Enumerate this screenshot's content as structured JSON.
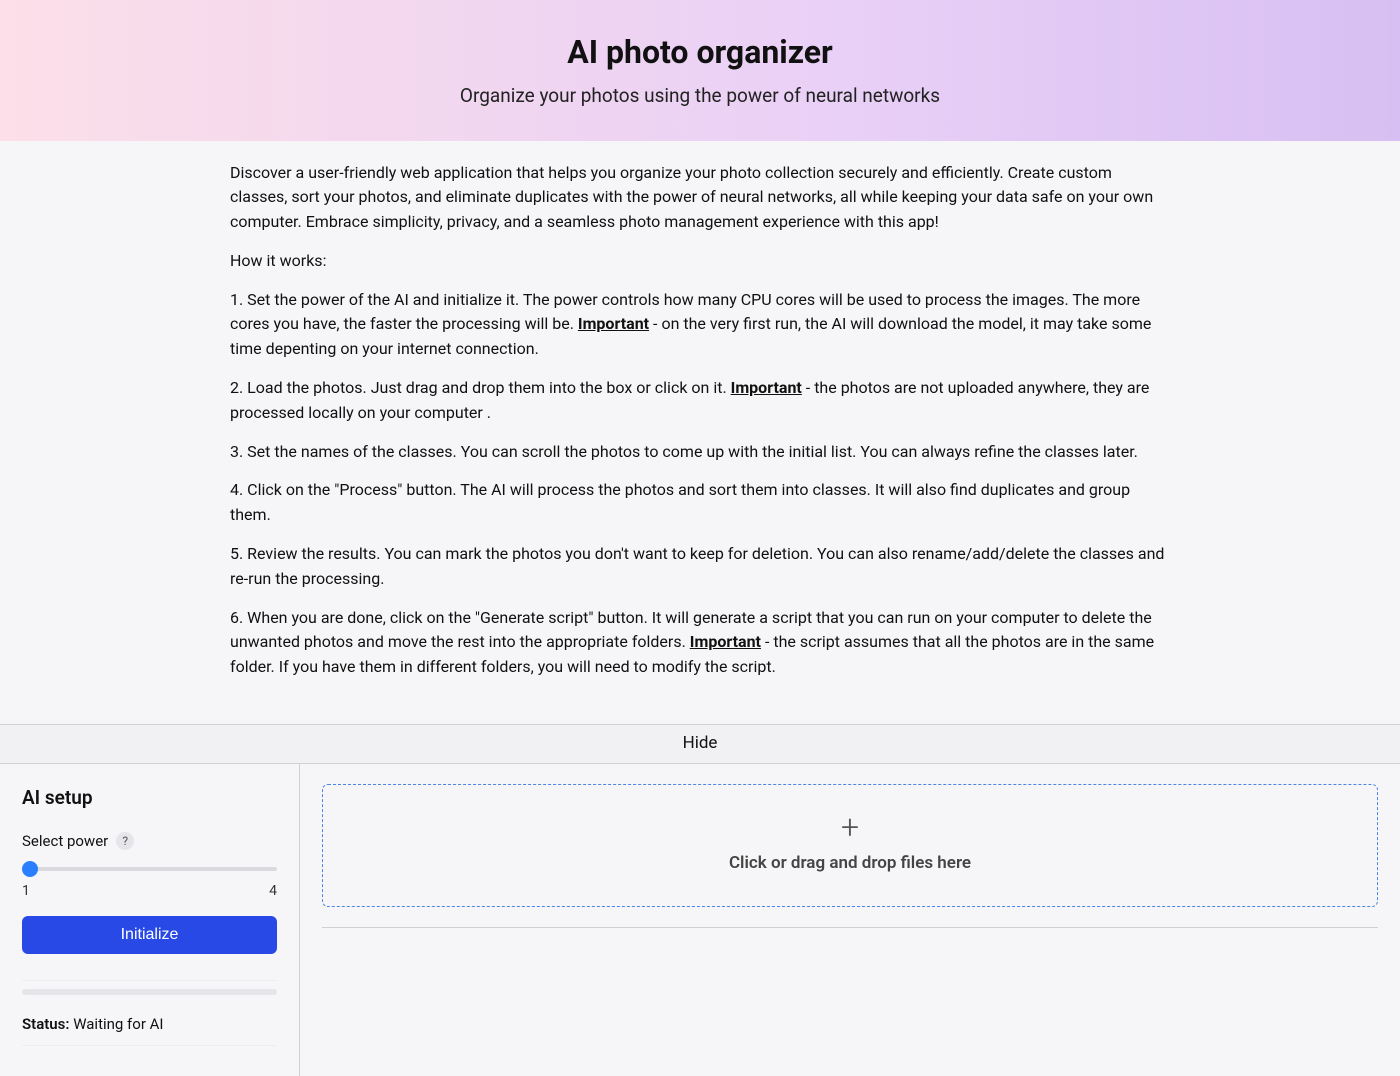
{
  "hero": {
    "title": "AI photo organizer",
    "subtitle": "Organize your photos using the power of neural networks"
  },
  "intro": "Discover a user-friendly web application that helps you organize your photo collection securely and efficiently. Create custom classes, sort your photos, and eliminate duplicates with the power of neural networks, all while keeping your data safe on your own computer. Embrace simplicity, privacy, and a seamless photo management experience with this app!",
  "howitworks_label": "How it works:",
  "steps": {
    "s1a": "1. Set the power of the AI and initialize it. The power controls how many CPU cores will be used to process the images. The more cores you have, the faster the processing will be. ",
    "s1b": " - on the very first run, the AI will download the model, it may take some time depenting on your internet connection.",
    "s2a": "2. Load the photos. Just drag and drop them into the box or click on it. ",
    "s2b": " - the photos are not uploaded anywhere, they are processed locally on your computer .",
    "s3": "3. Set the names of the classes. You can scroll the photos to come up with the initial list. You can always refine the classes later.",
    "s4": "4. Click on the \"Process\" button. The AI will process the photos and sort them into classes. It will also find duplicates and group them.",
    "s5": "5. Review the results. You can mark the photos you don't want to keep for deletion. You can also rename/add/delete the classes and re-run the processing.",
    "s6a": "6. When you are done, click on the \"Generate script\" button. It will generate a script that you can run on your computer to delete the unwanted photos and move the rest into the appropriate folders. ",
    "s6b": " - the script assumes that all the photos are in the same folder. If you have them in different folders, you will need to modify the script.",
    "important": "Important"
  },
  "hide_bar": "Hide",
  "sidebar": {
    "title": "AI setup",
    "power_label": "Select power",
    "help_char": "?",
    "range_min": "1",
    "range_max": "4",
    "init_button": "Initialize",
    "status_label": "Status:",
    "status_value": " Waiting for AI"
  },
  "dropzone": {
    "plus": "+",
    "label": "Click or drag and drop files here"
  }
}
